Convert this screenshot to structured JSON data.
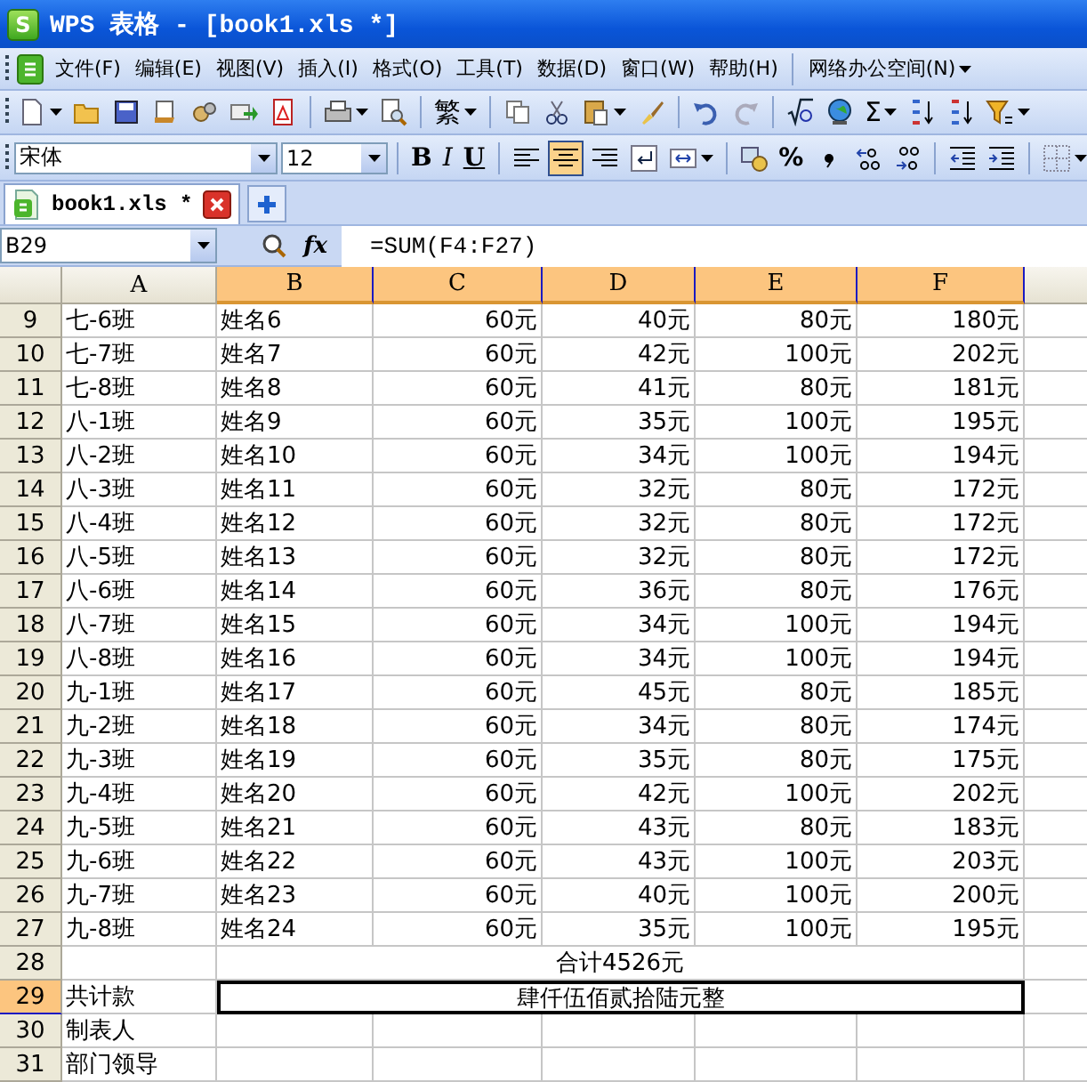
{
  "window": {
    "logo": "S",
    "title": "WPS 表格 - [book1.xls *]"
  },
  "menu": {
    "items": [
      "文件(F)",
      "编辑(E)",
      "视图(V)",
      "插入(I)",
      "格式(O)",
      "工具(T)",
      "数据(D)",
      "窗口(W)",
      "帮助(H)"
    ],
    "extra": "网络办公空间(N)"
  },
  "toolbar": {
    "traditional": "繁",
    "sum": "Σ"
  },
  "format_toolbar": {
    "font": "宋体",
    "size": "12",
    "bold": "B",
    "italic": "I",
    "underline": "U",
    "alignment": [
      {
        "selected": false
      },
      {
        "selected": true
      },
      {
        "selected": false
      }
    ],
    "percent": "%"
  },
  "tabs": [
    {
      "label": "book1.xls *",
      "selected": true
    }
  ],
  "formula_bar": {
    "name_box": "B29",
    "function_label": "fx",
    "formula": "=SUM(F4:F27)"
  },
  "sheet": {
    "columns": [
      {
        "label": "A",
        "selected": false
      },
      {
        "label": "B",
        "selected": true
      },
      {
        "label": "C",
        "selected": true
      },
      {
        "label": "D",
        "selected": true
      },
      {
        "label": "E",
        "selected": true
      },
      {
        "label": "F",
        "selected": true
      }
    ],
    "rows": [
      {
        "number": "9",
        "selected": false,
        "kind": "data",
        "cells": [
          "七-6班",
          "姓名6",
          "60元",
          "40元",
          "80元",
          "180元"
        ]
      },
      {
        "number": "10",
        "selected": false,
        "kind": "data",
        "cells": [
          "七-7班",
          "姓名7",
          "60元",
          "42元",
          "100元",
          "202元"
        ]
      },
      {
        "number": "11",
        "selected": false,
        "kind": "data",
        "cells": [
          "七-8班",
          "姓名8",
          "60元",
          "41元",
          "80元",
          "181元"
        ]
      },
      {
        "number": "12",
        "selected": false,
        "kind": "data",
        "cells": [
          "八-1班",
          "姓名9",
          "60元",
          "35元",
          "100元",
          "195元"
        ]
      },
      {
        "number": "13",
        "selected": false,
        "kind": "data",
        "cells": [
          "八-2班",
          "姓名10",
          "60元",
          "34元",
          "100元",
          "194元"
        ]
      },
      {
        "number": "14",
        "selected": false,
        "kind": "data",
        "cells": [
          "八-3班",
          "姓名11",
          "60元",
          "32元",
          "80元",
          "172元"
        ]
      },
      {
        "number": "15",
        "selected": false,
        "kind": "data",
        "cells": [
          "八-4班",
          "姓名12",
          "60元",
          "32元",
          "80元",
          "172元"
        ]
      },
      {
        "number": "16",
        "selected": false,
        "kind": "data",
        "cells": [
          "八-5班",
          "姓名13",
          "60元",
          "32元",
          "80元",
          "172元"
        ]
      },
      {
        "number": "17",
        "selected": false,
        "kind": "data",
        "cells": [
          "八-6班",
          "姓名14",
          "60元",
          "36元",
          "80元",
          "176元"
        ]
      },
      {
        "number": "18",
        "selected": false,
        "kind": "data",
        "cells": [
          "八-7班",
          "姓名15",
          "60元",
          "34元",
          "100元",
          "194元"
        ]
      },
      {
        "number": "19",
        "selected": false,
        "kind": "data",
        "cells": [
          "八-8班",
          "姓名16",
          "60元",
          "34元",
          "100元",
          "194元"
        ]
      },
      {
        "number": "20",
        "selected": false,
        "kind": "data",
        "cells": [
          "九-1班",
          "姓名17",
          "60元",
          "45元",
          "80元",
          "185元"
        ]
      },
      {
        "number": "21",
        "selected": false,
        "kind": "data",
        "cells": [
          "九-2班",
          "姓名18",
          "60元",
          "34元",
          "80元",
          "174元"
        ]
      },
      {
        "number": "22",
        "selected": false,
        "kind": "data",
        "cells": [
          "九-3班",
          "姓名19",
          "60元",
          "35元",
          "80元",
          "175元"
        ]
      },
      {
        "number": "23",
        "selected": false,
        "kind": "data",
        "cells": [
          "九-4班",
          "姓名20",
          "60元",
          "42元",
          "100元",
          "202元"
        ]
      },
      {
        "number": "24",
        "selected": false,
        "kind": "data",
        "cells": [
          "九-5班",
          "姓名21",
          "60元",
          "43元",
          "80元",
          "183元"
        ]
      },
      {
        "number": "25",
        "selected": false,
        "kind": "data",
        "cells": [
          "九-6班",
          "姓名22",
          "60元",
          "43元",
          "100元",
          "203元"
        ]
      },
      {
        "number": "26",
        "selected": false,
        "kind": "data",
        "cells": [
          "九-7班",
          "姓名23",
          "60元",
          "40元",
          "100元",
          "200元"
        ]
      },
      {
        "number": "27",
        "selected": false,
        "kind": "data",
        "cells": [
          "九-8班",
          "姓名24",
          "60元",
          "35元",
          "100元",
          "195元"
        ]
      },
      {
        "number": "28",
        "selected": false,
        "kind": "merged",
        "merged_text": "合计4526元"
      },
      {
        "number": "29",
        "selected": true,
        "kind": "merged",
        "first": "共计款",
        "merged_text": "肆仟伍佰贰拾陆元整"
      },
      {
        "number": "30",
        "selected": false,
        "kind": "label",
        "first": "制表人"
      },
      {
        "number": "31",
        "selected": false,
        "kind": "label",
        "first": "部门领导"
      }
    ]
  }
}
